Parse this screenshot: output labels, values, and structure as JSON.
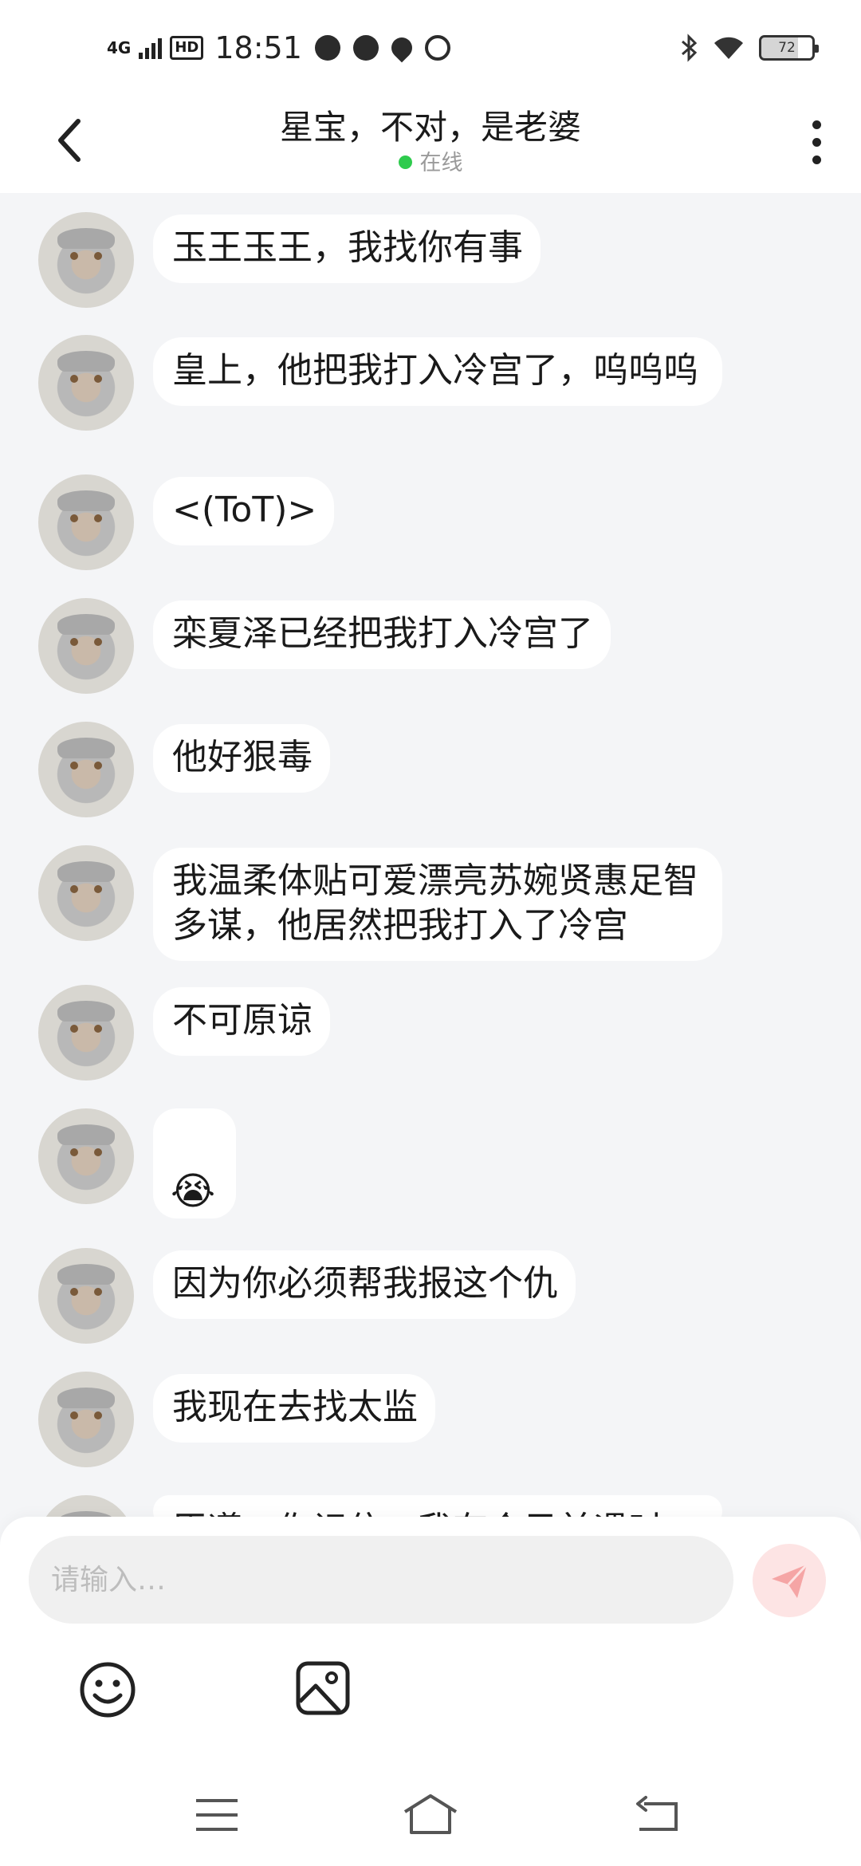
{
  "status_bar": {
    "network": "4G",
    "hd": "HD",
    "time": "18:51",
    "battery": "72"
  },
  "header": {
    "title": "星宝，不对，是老婆",
    "status": "在线"
  },
  "messages": [
    {
      "text": "玉王玉王，我找你有事"
    },
    {
      "text": "皇上，他把我打入冷宫了，呜呜呜"
    },
    {
      "text": "<(ToT)>"
    },
    {
      "text": "栾夏泽已经把我打入冷宫了"
    },
    {
      "text": "他好狠毒"
    },
    {
      "text": "我温柔体贴可爱漂亮苏婉贤惠足智多谋，他居然把我打入了冷宫"
    },
    {
      "text": "不可原谅"
    },
    {
      "emoji": "😭"
    },
    {
      "text": "因为你必须帮我报这个仇"
    },
    {
      "text": "我现在去找太监"
    },
    {
      "text": "臣遵，你记住，我有个目前遇时"
    }
  ],
  "input": {
    "placeholder": "请输入…"
  },
  "colors": {
    "online_dot": "#2ecb4d",
    "send_button_bg": "#fde4e4",
    "send_icon": "#f5a5a5",
    "chat_bg": "#f4f5f7"
  },
  "icons": [
    "back-arrow-icon",
    "more-vertical-icon",
    "send-icon",
    "smiley-icon",
    "image-icon",
    "menu-icon",
    "home-icon",
    "back-icon"
  ]
}
